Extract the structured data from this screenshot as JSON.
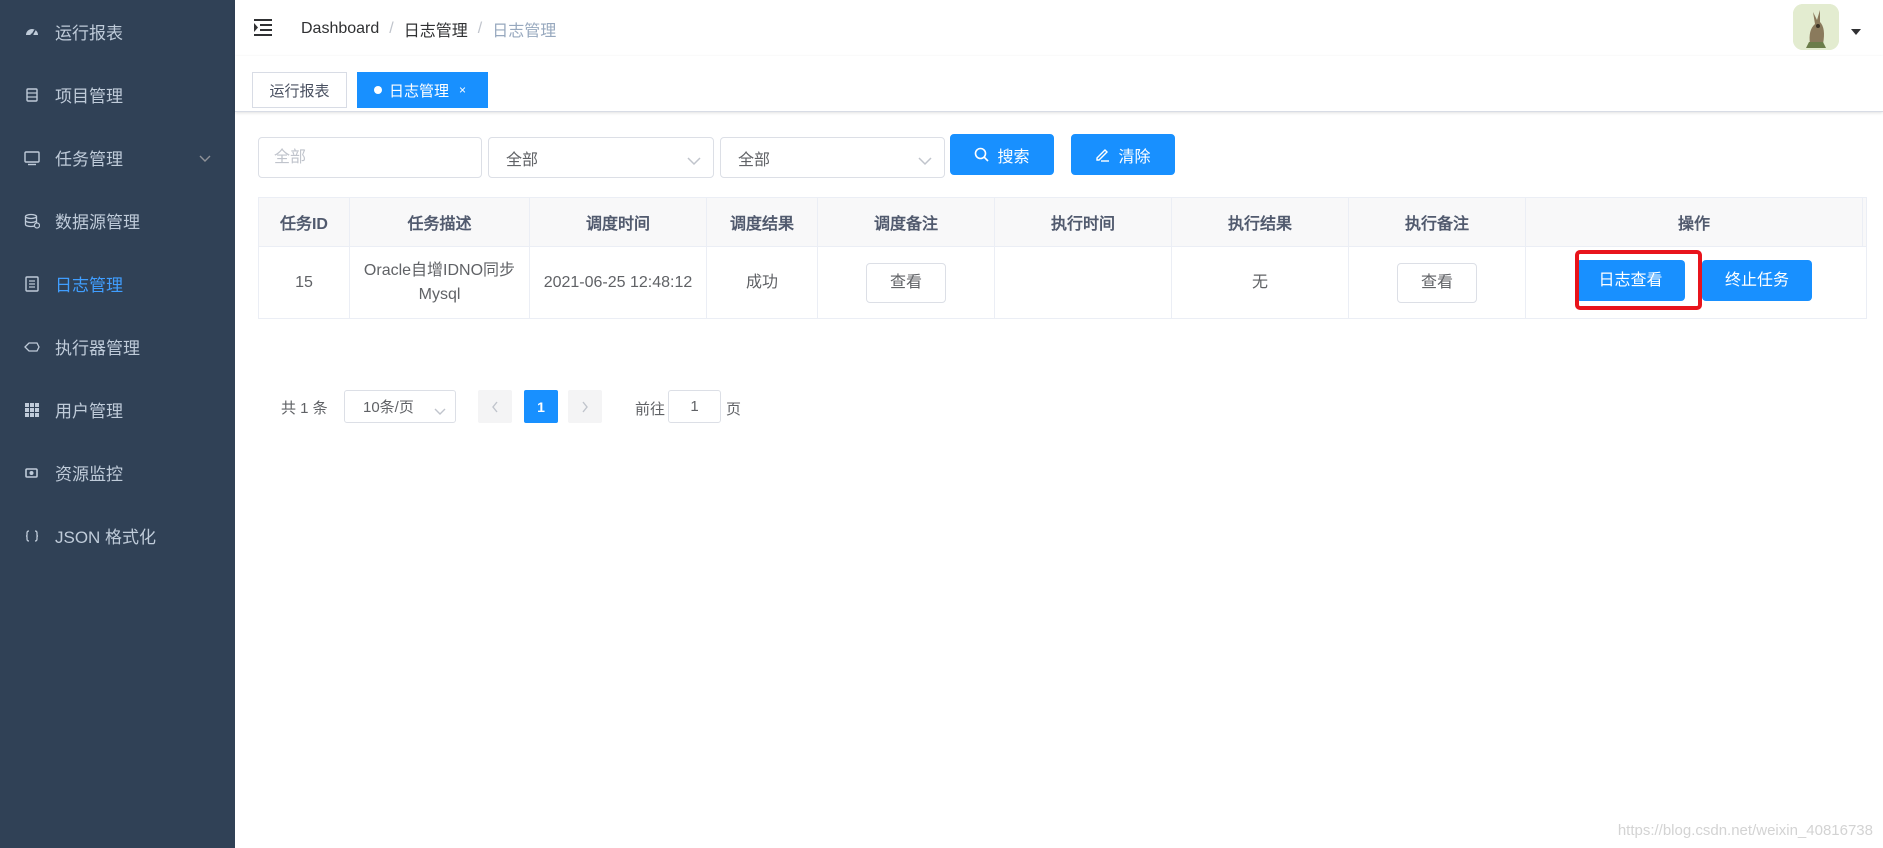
{
  "sidebar": {
    "items": [
      {
        "label": "运行报表",
        "icon": "dashboard-icon"
      },
      {
        "label": "项目管理",
        "icon": "project-icon"
      },
      {
        "label": "任务管理",
        "icon": "monitor-icon",
        "has_submenu": true
      },
      {
        "label": "数据源管理",
        "icon": "database-icon"
      },
      {
        "label": "日志管理",
        "icon": "log-icon",
        "active": true
      },
      {
        "label": "执行器管理",
        "icon": "executor-icon"
      },
      {
        "label": "用户管理",
        "icon": "user-grid-icon"
      },
      {
        "label": "资源监控",
        "icon": "monitor-resource-icon"
      },
      {
        "label": "JSON 格式化",
        "icon": "json-braces-icon"
      }
    ]
  },
  "header": {
    "breadcrumb": [
      "Dashboard",
      "日志管理",
      "日志管理"
    ],
    "breadcrumb_sep": "/"
  },
  "tags": {
    "items": [
      {
        "label": "运行报表",
        "active": false
      },
      {
        "label": "日志管理",
        "active": true,
        "close": "×"
      }
    ]
  },
  "filters": {
    "keyword_placeholder": "全部",
    "select1_value": "全部",
    "select2_value": "全部",
    "search_label": "搜索",
    "clear_label": "清除"
  },
  "table": {
    "headers": [
      "任务ID",
      "任务描述",
      "调度时间",
      "调度结果",
      "调度备注",
      "执行时间",
      "执行结果",
      "执行备注",
      "操作"
    ],
    "rows": [
      {
        "id": "15",
        "desc": "Oracle自增IDNO同步Mysql",
        "schedule_time": "2021-06-25 12:48:12",
        "schedule_result": "成功",
        "schedule_note_btn": "查看",
        "exec_time": "",
        "exec_result": "无",
        "exec_note_btn": "查看",
        "op_log_btn": "日志查看",
        "op_stop_btn": "终止任务"
      }
    ]
  },
  "pagination": {
    "total_text": "共 1 条",
    "page_size": "10条/页",
    "current_page": "1",
    "goto_label": "前往",
    "goto_value": "1",
    "page_suffix": "页"
  },
  "watermark": "https://blog.csdn.net/weixin_40816738",
  "colors": {
    "sidebar_bg": "#304156",
    "sidebar_text": "#bfcbd9",
    "active": "#409eff",
    "primary": "#1890ff",
    "highlight": "#e8141c"
  }
}
